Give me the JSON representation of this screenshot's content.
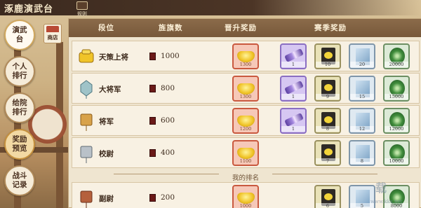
{
  "app": {
    "title": "涿鹿演武台",
    "rules_label": "规则"
  },
  "nav": {
    "items": [
      {
        "label": "演武台"
      },
      {
        "label": "个人排行"
      },
      {
        "label": "给院排行"
      },
      {
        "label": "奖励预览"
      },
      {
        "label": "战斗记录"
      }
    ],
    "shop_label": "商店"
  },
  "table": {
    "headers": {
      "rank": "段位",
      "flags": "旌旗数",
      "promotion": "晋升奖励",
      "season": "赛季奖励"
    },
    "rows": [
      {
        "rank": "天策上将",
        "flags": "1000",
        "promo_qty": "1300",
        "rewards": [
          {
            "type": "scroll",
            "qty": "1"
          },
          {
            "type": "book",
            "qty": "10"
          },
          {
            "type": "paper",
            "qty": "20"
          },
          {
            "type": "green",
            "qty": "20000"
          }
        ]
      },
      {
        "rank": "大将军",
        "flags": "800",
        "promo_qty": "1300",
        "rewards": [
          {
            "type": "scroll",
            "qty": "1"
          },
          {
            "type": "book",
            "qty": "9"
          },
          {
            "type": "paper",
            "qty": "15"
          },
          {
            "type": "green",
            "qty": "15000"
          }
        ]
      },
      {
        "rank": "将军",
        "flags": "600",
        "promo_qty": "1200",
        "rewards": [
          {
            "type": "scroll",
            "qty": "1"
          },
          {
            "type": "book",
            "qty": "8"
          },
          {
            "type": "paper",
            "qty": "12"
          },
          {
            "type": "green",
            "qty": "12000"
          }
        ]
      },
      {
        "rank": "校尉",
        "flags": "400",
        "promo_qty": "1100",
        "rewards": [
          {
            "type": "book",
            "qty": "7"
          },
          {
            "type": "paper",
            "qty": "8"
          },
          {
            "type": "green",
            "qty": "10000"
          }
        ]
      }
    ],
    "my_rank_label": "我的排名",
    "my_row": {
      "rank": "副尉",
      "flags": "200",
      "promo_qty": "1000",
      "rewards": [
        {
          "type": "book",
          "qty": "6"
        },
        {
          "type": "paper",
          "qty": "5"
        },
        {
          "type": "green",
          "qty": "8000"
        }
      ]
    }
  },
  "watermark": {
    "text": "载",
    "url": "www.kkx.net"
  }
}
